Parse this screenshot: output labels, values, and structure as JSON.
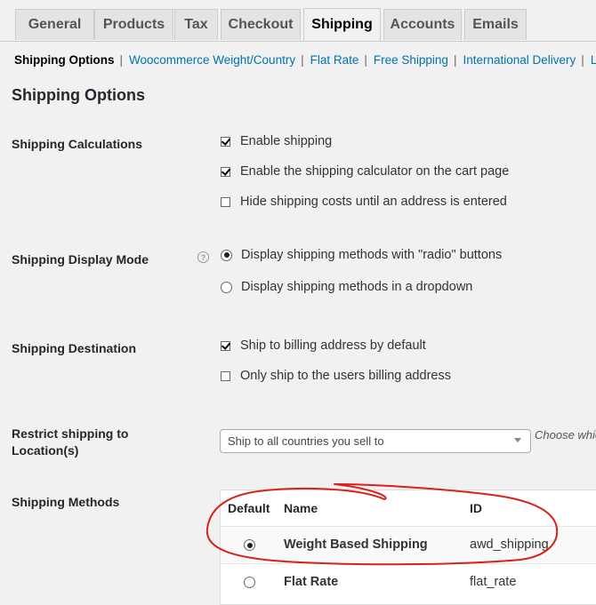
{
  "tabs": [
    {
      "label": "General",
      "active": false
    },
    {
      "label": "Products",
      "active": false
    },
    {
      "label": "Tax",
      "active": false
    },
    {
      "label": "Checkout",
      "active": false
    },
    {
      "label": "Shipping",
      "active": true
    },
    {
      "label": "Accounts",
      "active": false
    },
    {
      "label": "Emails",
      "active": false
    }
  ],
  "subnav": {
    "current": "Shipping Options",
    "separator": "|",
    "links": [
      "Woocommerce Weight/Country",
      "Flat Rate",
      "Free Shipping",
      "International Delivery",
      "Lo"
    ]
  },
  "section_title": "Shipping Options",
  "calculations": {
    "label": "Shipping Calculations",
    "options": [
      {
        "label": "Enable shipping",
        "checked": true
      },
      {
        "label": "Enable the shipping calculator on the cart page",
        "checked": true
      },
      {
        "label": "Hide shipping costs until an address is entered",
        "checked": false
      }
    ]
  },
  "display_mode": {
    "label": "Shipping Display Mode",
    "help_icon": "question-circle-icon",
    "help_glyph": "?",
    "options": [
      {
        "label": "Display shipping methods with \"radio\" buttons",
        "selected": true
      },
      {
        "label": "Display shipping methods in a dropdown",
        "selected": false
      }
    ]
  },
  "destination": {
    "label": "Shipping Destination",
    "options": [
      {
        "label": "Ship to billing address by default",
        "checked": true
      },
      {
        "label": "Only ship to the users billing address",
        "checked": false
      }
    ]
  },
  "restrict": {
    "label_line1": "Restrict shipping to",
    "label_line2": "Location(s)",
    "selected": "Ship to all countries you sell to",
    "description": "Choose which"
  },
  "methods": {
    "label": "Shipping Methods",
    "columns": [
      "Default",
      "Name",
      "ID"
    ],
    "rows": [
      {
        "default": true,
        "name": "Weight Based Shipping",
        "id": "awd_shipping"
      },
      {
        "default": false,
        "name": "Flat Rate",
        "id": "flat_rate"
      }
    ]
  },
  "colors": {
    "link": "#0073aa",
    "annotation": "#d9211c",
    "background": "#f1f1f1"
  }
}
